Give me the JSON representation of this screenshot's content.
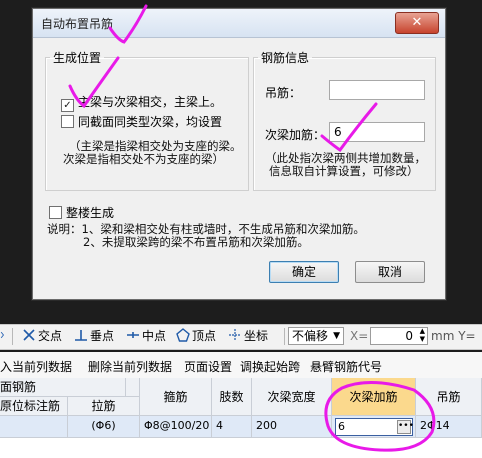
{
  "dialog": {
    "title": "自动布置吊筋",
    "close_glyph": "✕",
    "group_position": {
      "legend": "生成位置",
      "option1": "主梁与次梁相交，主梁上。",
      "option1_checked": true,
      "option2": "同截面同类型次梁，均设置",
      "option2_checked": false,
      "note_line1": "（主梁是指梁相交处为支座的梁。",
      "note_line2": "次梁是指相交处不为支座的梁）"
    },
    "group_rebar": {
      "legend": "钢筋信息",
      "hanger_label": "吊筋：",
      "hanger_value": "",
      "secondary_label": "次梁加筋：",
      "secondary_value": "6",
      "note_line1": "（此处指次梁两侧共增加数量，",
      "note_line2": "信息取自计算设置，可修改）"
    },
    "whole_floor": "整楼生成",
    "whole_floor_checked": false,
    "explain_line1": "说明：1、梁和梁相交处有柱或墙时，不生成吊筋和次梁加筋。",
    "explain_line2": "2、未提取梁跨的梁不布置吊筋和次梁加筋。",
    "ok_label": "确定",
    "cancel_label": "取消"
  },
  "toolbar": {
    "intersection": "交点",
    "perp": "垂点",
    "midpoint": "中点",
    "vertex": "顶点",
    "coordinate": "坐标",
    "offset_select": "不偏移",
    "x_label": "X=",
    "x_value": "0",
    "unit_y": "mm Y="
  },
  "menubar": {
    "item1": "输入当前列数据",
    "item2": "删除当前列数据",
    "item3": "页面设置",
    "item4": "调换起始跨",
    "item5": "悬臂钢筋代号"
  },
  "grid": {
    "header_group": "面钢筋",
    "col_origin": "原位标注筋",
    "col_tie": "拉筋",
    "col_stirrup": "箍筋",
    "col_legs": "肢数",
    "col_width": "次梁宽度",
    "col_secondary": "次梁加筋",
    "col_hanger": "吊筋",
    "row": {
      "origin": "",
      "tie": "(Φ6)",
      "stirrup": "Φ8@100/20",
      "legs": "4",
      "width": "200",
      "secondary": "6",
      "hanger": "2Φ14"
    }
  },
  "colors": {
    "annotation": "#e81ae8",
    "highlight_header": "#fbd98d",
    "selected_row": "#dfe9f7"
  }
}
